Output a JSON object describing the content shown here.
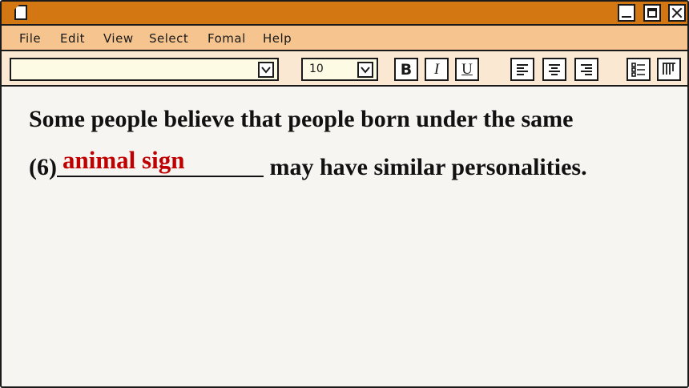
{
  "menu": {
    "items": [
      "File",
      "Edit",
      "View",
      "Select",
      "Fomal",
      "Help"
    ]
  },
  "toolbar": {
    "font_name": "",
    "font_size": "10",
    "bold_label": "B",
    "italic_label": "I",
    "underline_label": "U"
  },
  "document": {
    "line1": "Some people believe that people born under the same",
    "line2_prefix": "(6)",
    "line2_suffix": " may have similar personalities.",
    "answer": "animal sign",
    "answer_color": "#c00000"
  },
  "colors": {
    "titlebar": "#d27712",
    "menubar": "#f5c48f",
    "toolbar": "#fbe8d2",
    "canvas": "#f7f5f2"
  }
}
